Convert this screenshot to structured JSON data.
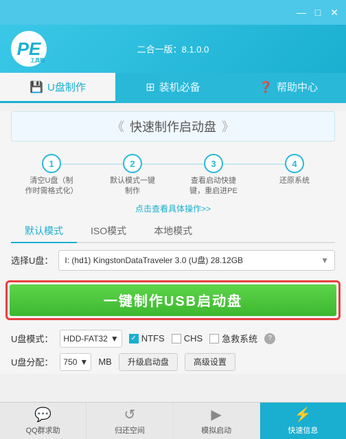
{
  "titleBar": {
    "minimize": "—",
    "restore": "□",
    "close": "✕"
  },
  "header": {
    "logo": "PE",
    "version": "二合一版：8.1.0.0"
  },
  "navTabs": [
    {
      "id": "udisk",
      "icon": "💾",
      "label": "U盘制作",
      "active": true
    },
    {
      "id": "install",
      "icon": "⊞",
      "label": "装机必备",
      "active": false
    },
    {
      "id": "help",
      "icon": "?",
      "label": "帮助中心",
      "active": false
    }
  ],
  "quickBanner": {
    "chevronLeft": "《",
    "title": "快速制作启动盘",
    "chevronRight": "》"
  },
  "steps": [
    {
      "num": "1",
      "text": "清空U盘（制\n作时需格式化）"
    },
    {
      "num": "2",
      "text": "默认模式一键\n制作"
    },
    {
      "num": "3",
      "text": "查看启动快捷\n键，重启进PE"
    },
    {
      "num": "4",
      "text": "还原系统"
    }
  ],
  "moreLink": "点击查看具体操作>>",
  "modeTabs": [
    {
      "label": "默认模式",
      "active": true
    },
    {
      "label": "ISO模式",
      "active": false
    },
    {
      "label": "本地模式",
      "active": false
    }
  ],
  "selectUdisk": {
    "label": "选择U盘：",
    "value": "I: (hd1) KingstonDataTraveler 3.0 (U盘) 28.12GB"
  },
  "mainButton": {
    "label": "一键制作USB启动盘"
  },
  "options1": {
    "modeLabel": "U盘模式：",
    "modeValue": "HDD-FAT32",
    "ntfs": {
      "label": "NTFS",
      "checked": true
    },
    "chs": {
      "label": "CHS",
      "checked": false
    },
    "rescue": {
      "label": "急救系统",
      "checked": false
    }
  },
  "options2": {
    "partLabel": "U盘分配：",
    "partValue": "750",
    "partUnit": "MB",
    "upgradeBtn": "升级启动盘",
    "advancedBtn": "高级设置"
  },
  "bottomBar": [
    {
      "id": "qq",
      "icon": "💬",
      "label": "QQ群求助"
    },
    {
      "id": "restore",
      "icon": "↺",
      "label": "归还空间"
    },
    {
      "id": "simulate",
      "icon": "▶",
      "label": "模拟启动"
    },
    {
      "id": "quick",
      "icon": "⚡",
      "label": "快速信息"
    }
  ]
}
